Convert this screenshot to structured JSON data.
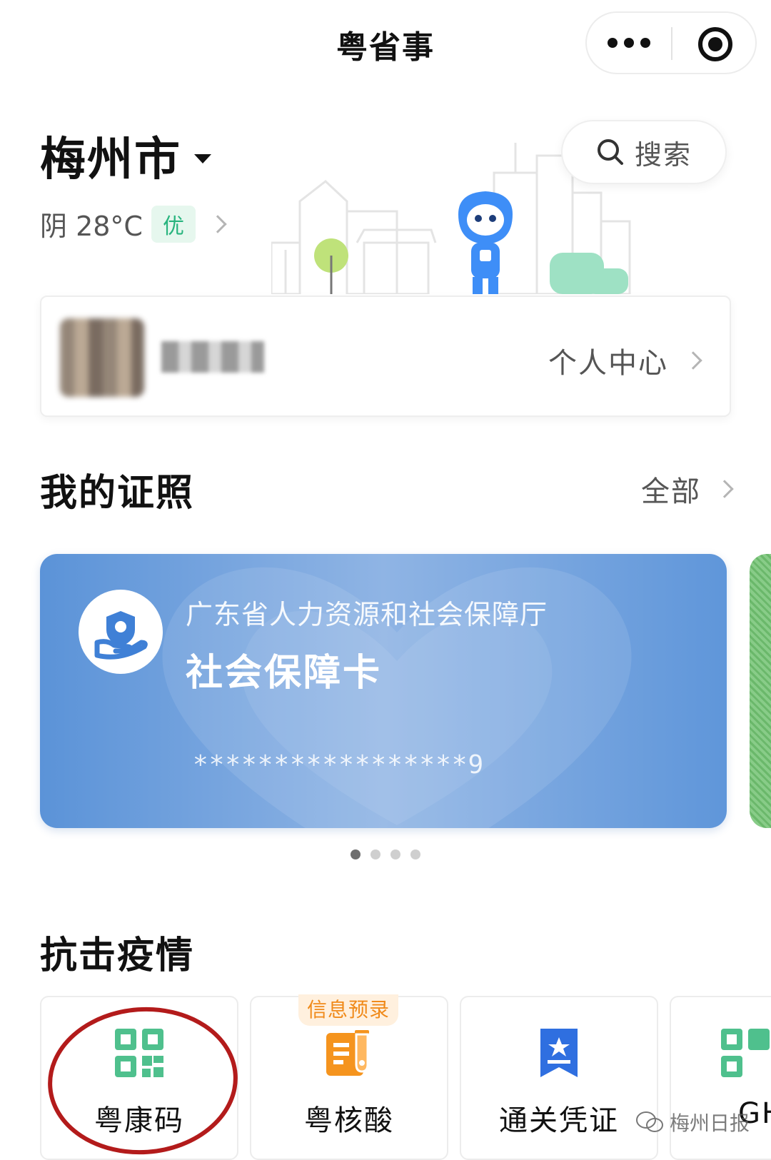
{
  "navbar": {
    "title": "粤省事"
  },
  "city": {
    "name": "梅州市"
  },
  "weather": {
    "text": "阴 28°C",
    "aqi": "优"
  },
  "search": {
    "label": "搜索"
  },
  "user": {
    "center_label": "个人中心"
  },
  "certs": {
    "title": "我的证照",
    "more_label": "全部",
    "card": {
      "issuer": "广东省人力资源和社会保障厅",
      "name": "社会保障卡",
      "number": "*****************9"
    },
    "pager": {
      "count": 4,
      "active": 0
    }
  },
  "epidemic": {
    "title": "抗击疫情",
    "tiles": [
      {
        "label": "粤康码",
        "icon": "qr-code-icon"
      },
      {
        "label": "粤核酸",
        "icon": "test-tube-icon",
        "tag": "信息预录"
      },
      {
        "label": "通关凭证",
        "icon": "ribbon-star-icon"
      },
      {
        "label": "GH",
        "icon": "qr-code-icon"
      }
    ]
  },
  "watermark": "梅州日报",
  "colors": {
    "brand_green": "#28b47e",
    "card_blue": "#5b93d8",
    "qr_green": "#4fc08d",
    "test_orange": "#f5941e",
    "ribbon_blue": "#2f6fe0",
    "highlight_red": "#b31b1b"
  }
}
